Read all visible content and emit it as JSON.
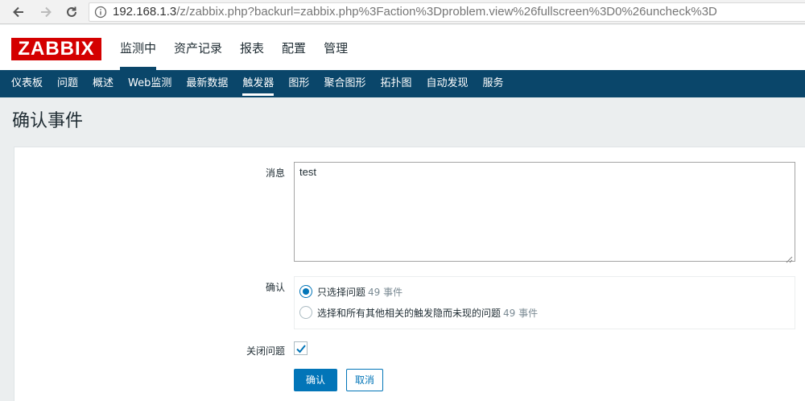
{
  "browser": {
    "url_host": "192.168.1.3",
    "url_path": "/z/zabbix.php?backurl=zabbix.php%3Faction%3Dproblem.view%26fullscreen%3D0%26uncheck%3D"
  },
  "header": {
    "logo_text": "ZABBIX",
    "menu": [
      "监测中",
      "资产记录",
      "报表",
      "配置",
      "管理"
    ]
  },
  "subnav": [
    "仪表板",
    "问题",
    "概述",
    "Web监测",
    "最新数据",
    "触发器",
    "图形",
    "聚合图形",
    "拓扑图",
    "自动发现",
    "服务"
  ],
  "page": {
    "title": "确认事件"
  },
  "form": {
    "message_label": "消息",
    "message_value": "test",
    "ack_label": "确认",
    "option1_text": "只选择问题",
    "option1_count": "49 事件",
    "option2_text": "选择和所有其他相关的触发隐而未现的问题",
    "option2_count": "49 事件",
    "close_label": "关闭问题",
    "close_checked": true,
    "submit_label": "确认",
    "cancel_label": "取消"
  },
  "colors": {
    "nav": "#0a466a",
    "accent": "#0275b8",
    "logo": "#d40000"
  }
}
